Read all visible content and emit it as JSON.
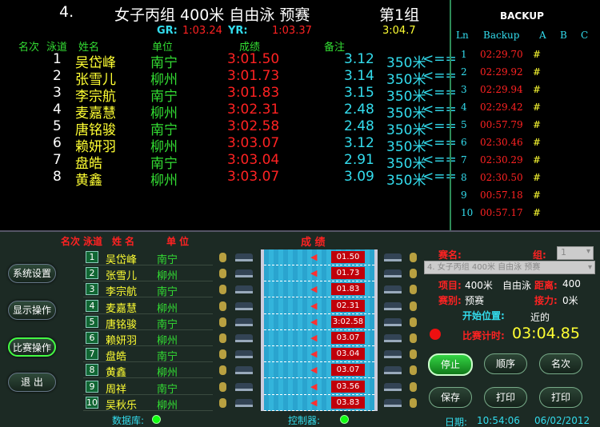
{
  "header": {
    "event_no": "4.",
    "event_name": "女子丙组 400米  自由泳 预赛",
    "heat": "第1组",
    "gr_label": "GR:",
    "gr_value": "1:03.24",
    "yr_label": "YR:",
    "yr_value": "1:03.37",
    "extra": "3:04.7"
  },
  "results_headers": {
    "rank": "名次",
    "lane": "泳道",
    "name": "姓名",
    "unit": "单位",
    "score": "成绩",
    "note": "备注"
  },
  "results": [
    {
      "rank": "1",
      "name": "吴岱峰",
      "unit": "南宁",
      "time": "3:01.50",
      "split": "3.12",
      "dist": "350米",
      "mark": "<=="
    },
    {
      "rank": "2",
      "name": "张雪儿",
      "unit": "柳州",
      "time": "3:01.73",
      "split": "3.14",
      "dist": "350米",
      "mark": "<=="
    },
    {
      "rank": "3",
      "name": "李宗航",
      "unit": "南宁",
      "time": "3:01.83",
      "split": "3.15",
      "dist": "350米",
      "mark": "<=="
    },
    {
      "rank": "4",
      "name": "麦嘉慧",
      "unit": "柳州",
      "time": "3:02.31",
      "split": "2.48",
      "dist": "350米",
      "mark": "<=="
    },
    {
      "rank": "5",
      "name": "唐铭骏",
      "unit": "南宁",
      "time": "3:02.58",
      "split": "2.48",
      "dist": "350米",
      "mark": "<=="
    },
    {
      "rank": "6",
      "name": "赖妍羽",
      "unit": "柳州",
      "time": "3:03.07",
      "split": "3.12",
      "dist": "350米",
      "mark": "<=="
    },
    {
      "rank": "7",
      "name": "盘皓",
      "unit": "南宁",
      "time": "3:03.04",
      "split": "2.91",
      "dist": "350米",
      "mark": "<=="
    },
    {
      "rank": "8",
      "name": "黄鑫",
      "unit": "柳州",
      "time": "3:03.07",
      "split": "3.09",
      "dist": "350米",
      "mark": "<=="
    }
  ],
  "backup": {
    "title": "BACKUP",
    "col_ln": "Ln",
    "col_backup": "Backup",
    "col_a": "A",
    "col_b": "B",
    "col_c": "C",
    "rows": [
      {
        "ln": "1",
        "time": "02:29.70",
        "a": "#"
      },
      {
        "ln": "2",
        "time": "02:29.92",
        "a": "#"
      },
      {
        "ln": "3",
        "time": "02:29.94",
        "a": "#"
      },
      {
        "ln": "4",
        "time": "02:29.42",
        "a": "#"
      },
      {
        "ln": "5",
        "time": "00:57.79",
        "a": "#"
      },
      {
        "ln": "6",
        "time": "02:30.46",
        "a": "#"
      },
      {
        "ln": "7",
        "time": "02:30.29",
        "a": "#"
      },
      {
        "ln": "8",
        "time": "02:30.50",
        "a": "#"
      },
      {
        "ln": "9",
        "time": "00:57.18",
        "a": "#"
      },
      {
        "ln": "10",
        "time": "00:57.17",
        "a": "#"
      }
    ]
  },
  "sidebar": {
    "settings": "系统设置",
    "display": "显示操作",
    "race": "比赛操作",
    "exit": "退 出"
  },
  "lanes_header": {
    "rank": "名次",
    "lane": "泳道",
    "name": "姓 名",
    "unit": "单 位",
    "score": "成 绩"
  },
  "lanes": [
    {
      "lane": "1",
      "name": "吴岱峰",
      "unit": "南宁",
      "time": "01.50"
    },
    {
      "lane": "2",
      "name": "张雪儿",
      "unit": "柳州",
      "time": "01.73"
    },
    {
      "lane": "3",
      "name": "李宗航",
      "unit": "南宁",
      "time": "01.83"
    },
    {
      "lane": "4",
      "name": "麦嘉慧",
      "unit": "柳州",
      "time": "02.31"
    },
    {
      "lane": "5",
      "name": "唐铭骏",
      "unit": "南宁",
      "time": "3:02.58"
    },
    {
      "lane": "6",
      "name": "赖妍羽",
      "unit": "柳州",
      "time": "03.07"
    },
    {
      "lane": "7",
      "name": "盘皓",
      "unit": "南宁",
      "time": "03.04"
    },
    {
      "lane": "8",
      "name": "黄鑫",
      "unit": "柳州",
      "time": "03.07"
    },
    {
      "lane": "9",
      "name": "周祥",
      "unit": "南宁",
      "time": "03.56"
    },
    {
      "lane": "10",
      "name": "吴秋乐",
      "unit": "柳州",
      "time": "03.83"
    }
  ],
  "footer": {
    "db_label": "数据库:",
    "ctrl_label": "控制器:",
    "date_label": "日期:",
    "time": "10:54:06",
    "date": "06/02/2012"
  },
  "control": {
    "race_label": "赛名:",
    "group_label": "组:",
    "group_value": "1",
    "race_value": "4. 女子丙组 400米 自由泳 预赛",
    "item_label": "项目:",
    "item_value": "400米",
    "stroke": "自由泳",
    "dist_label": "距离:",
    "dist_value": "400",
    "type_label": "赛别:",
    "type_value": "预赛",
    "relay_label": "接力:",
    "relay_value": "0米",
    "start_label": "开始位置:",
    "start_value": "近的",
    "timer_label": "比赛计时:",
    "timer_value": "03:04.85",
    "btn_stop": "停止",
    "btn_order": "顺序",
    "btn_rank": "名次",
    "btn_save": "保存",
    "btn_print1": "打印",
    "btn_print2": "打印"
  },
  "colors": {
    "yellow": "#ffff33",
    "green": "#33dd33",
    "red": "#ff2222",
    "cyan": "#33ddee"
  }
}
